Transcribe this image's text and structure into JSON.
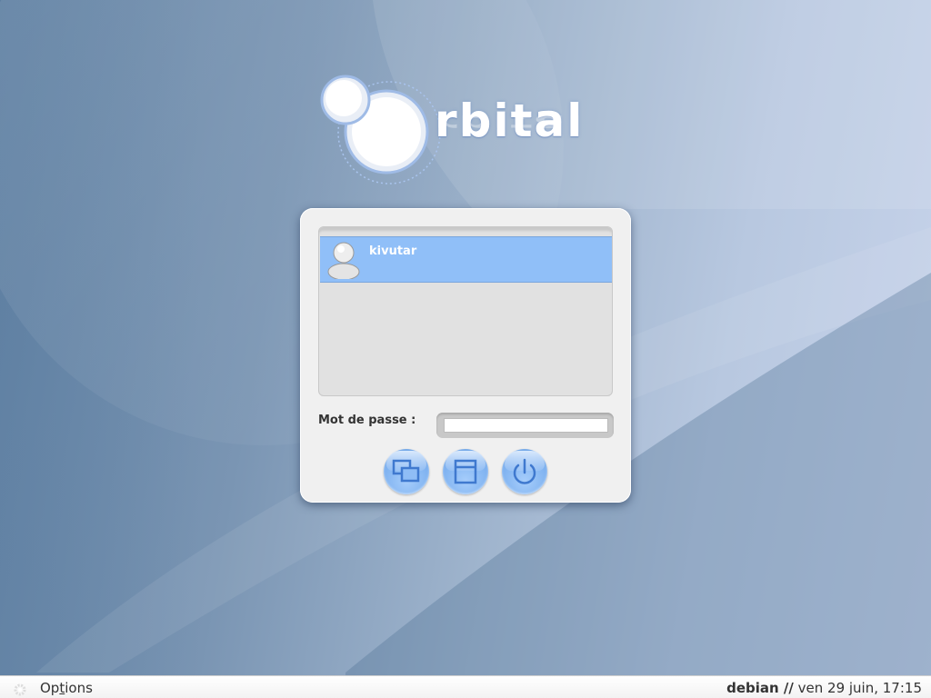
{
  "logo": {
    "text": "rbital",
    "brand_color": "#ffffff",
    "orb_color": "#ffffff"
  },
  "user_list": {
    "selected_color": "#90bff8",
    "users": [
      {
        "name": "kivutar",
        "icon": "user-avatar-icon"
      }
    ]
  },
  "password": {
    "label": "Mot de passe :",
    "value": ""
  },
  "buttons": {
    "sessions_icon": "windows-icon",
    "layout_icon": "window-icon",
    "power_icon": "power-icon",
    "accent": "#7fb2f0"
  },
  "bottom_bar": {
    "options_prefix": "Op",
    "options_underlined": "t",
    "options_suffix": "ions",
    "options_icon": "gear-icon",
    "hostname": "debian //",
    "datetime": "ven 29 juin, 17:15"
  }
}
